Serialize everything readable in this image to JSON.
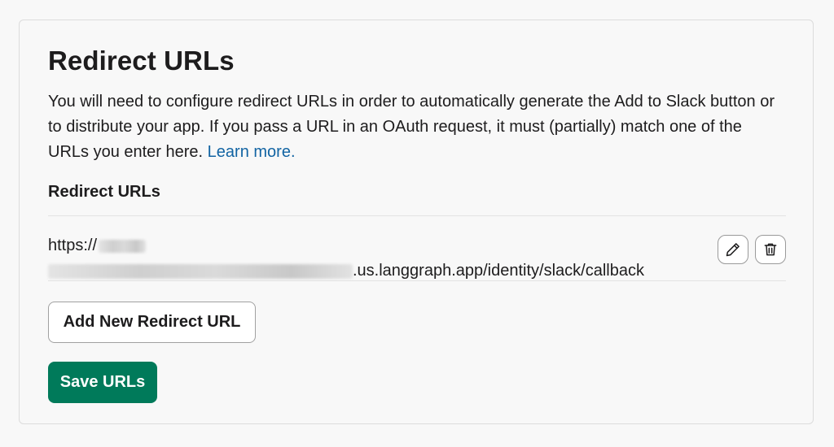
{
  "panel": {
    "title": "Redirect URLs",
    "description": "You will need to configure redirect URLs in order to automatically generate the Add to Slack button or to distribute your app. If you pass a URL in an OAuth request, it must (partially) match one of the URLs you enter here.",
    "learn_more_label": "Learn more."
  },
  "redirect_urls": {
    "section_label": "Redirect URLs",
    "items": [
      {
        "prefix": "https://",
        "suffix": ".us.langgraph.app/identity/slack/callback",
        "redacted": true,
        "edit_icon": "pencil-icon",
        "delete_icon": "trash-icon"
      }
    ]
  },
  "actions": {
    "add_label": "Add New Redirect URL",
    "save_label": "Save URLs"
  },
  "colors": {
    "primary": "#007a5a",
    "link": "#1264a3",
    "text": "#1d1c1d",
    "background": "#f8f8f8"
  }
}
